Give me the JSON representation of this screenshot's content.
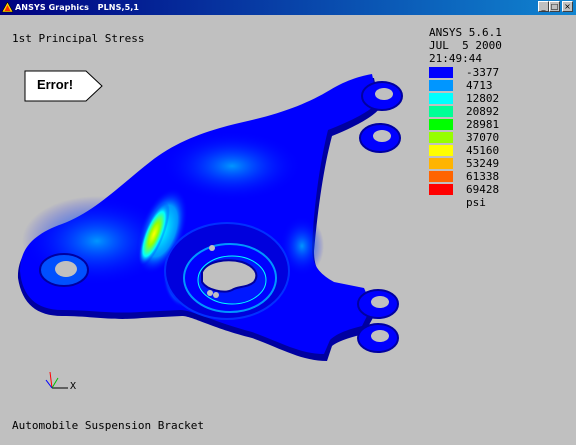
{
  "window": {
    "title": "ANSYS Graphics   PLNS,5,1",
    "minimize_glyph": "_",
    "maximize_glyph": "□",
    "close_glyph": "×"
  },
  "plot": {
    "title": "1st Principal Stress",
    "caption": "Automobile Suspension Bracket",
    "error_label": "Error!",
    "triad_axis": "X"
  },
  "header": {
    "version": "ANSYS 5.6.1",
    "date": "JUL  5 2000",
    "time": "21:49:44"
  },
  "legend": {
    "unit": "psi",
    "entries": [
      {
        "value": "-3377",
        "color": "#0000ff"
      },
      {
        "value": "4713",
        "color": "#0096ff"
      },
      {
        "value": "12802",
        "color": "#00ffff"
      },
      {
        "value": "20892",
        "color": "#00ff96"
      },
      {
        "value": "28981",
        "color": "#00ff00"
      },
      {
        "value": "37070",
        "color": "#96ff00"
      },
      {
        "value": "45160",
        "color": "#ffff00"
      },
      {
        "value": "53249",
        "color": "#ffb400"
      },
      {
        "value": "61338",
        "color": "#ff6400"
      },
      {
        "value": "69428",
        "color": "#ff0000"
      }
    ]
  }
}
